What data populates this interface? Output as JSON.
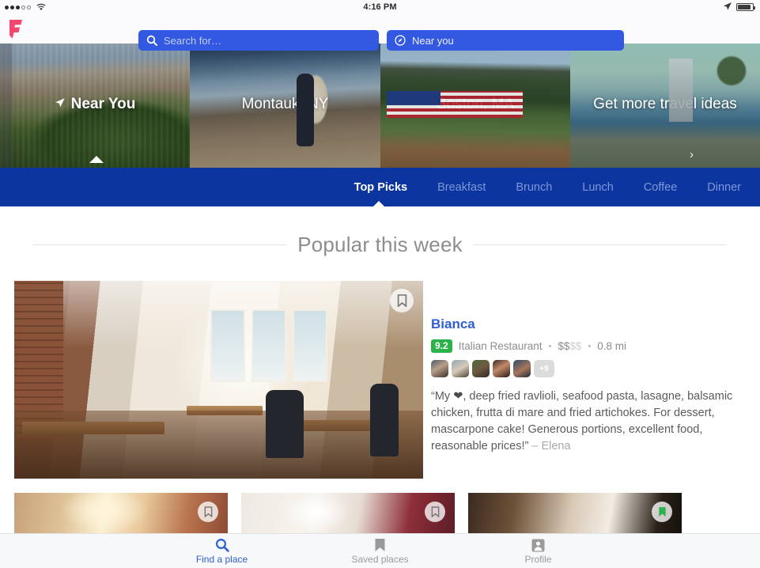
{
  "status_bar": {
    "signal_dots_filled": 3,
    "signal_dots_total": 5,
    "wifi_icon": "wifi-icon",
    "time": "4:16 PM",
    "location_icon": "location-arrow-icon",
    "battery_icon": "battery-icon"
  },
  "header": {
    "logo": "foursquare-logo",
    "search": {
      "icon": "search-icon",
      "placeholder": "Search for…",
      "value": ""
    },
    "near": {
      "icon": "compass-icon",
      "label": "Near you"
    }
  },
  "carousel": {
    "tiles": [
      {
        "label": "Near You",
        "icon": "location-arrow-icon",
        "active": true
      },
      {
        "label": "Montauk, NY",
        "icon": "",
        "active": false
      },
      {
        "label": "Boston, MA",
        "icon": "",
        "active": false
      },
      {
        "label": "Get more travel ideas",
        "icon": "",
        "active": false
      }
    ],
    "next_chevron": "chevron-right-icon"
  },
  "category_nav": {
    "accent_bg": "#0c35a0",
    "items": [
      {
        "label": "Top Picks",
        "active": true
      },
      {
        "label": "Breakfast",
        "active": false
      },
      {
        "label": "Brunch",
        "active": false
      },
      {
        "label": "Lunch",
        "active": false
      },
      {
        "label": "Coffee",
        "active": false
      },
      {
        "label": "Dinner",
        "active": false
      }
    ]
  },
  "section": {
    "title": "Popular this week"
  },
  "feature_venue": {
    "name": "Bianca",
    "name_color": "#2f5fd0",
    "rating": "9.2",
    "rating_color": "#2bb34b",
    "category": "Italian Restaurant",
    "price_on": "$$",
    "price_off": "$$",
    "distance": "0.8 mi",
    "separator": "•",
    "friends_more": "+9",
    "bookmark_icon": "bookmark-icon",
    "quote_part1": "“My ",
    "quote_heart": "❤",
    "quote_part2": ", deep fried ravlioli, seafood pasta, lasagne, balsamic chicken, frutta di mare and fried artichokes. For dessert, mascarpone cake! Generous portions, excellent food, reasonable prices!”",
    "quote_author": "– Elena"
  },
  "more_cards": [
    {
      "bookmark_icon": "bookmark-icon",
      "saved": false
    },
    {
      "bookmark_icon": "bookmark-icon",
      "saved": false
    },
    {
      "bookmark_icon": "bookmark-icon-filled",
      "saved": true,
      "saved_color": "#2bb34b"
    }
  ],
  "tab_bar": {
    "tabs": [
      {
        "label": "Find a place",
        "icon": "search-icon",
        "active": true
      },
      {
        "label": "Saved places",
        "icon": "bookmark-icon",
        "active": false
      },
      {
        "label": "Profile",
        "icon": "person-icon",
        "active": false
      }
    ],
    "active_color": "#2f5fd0"
  }
}
